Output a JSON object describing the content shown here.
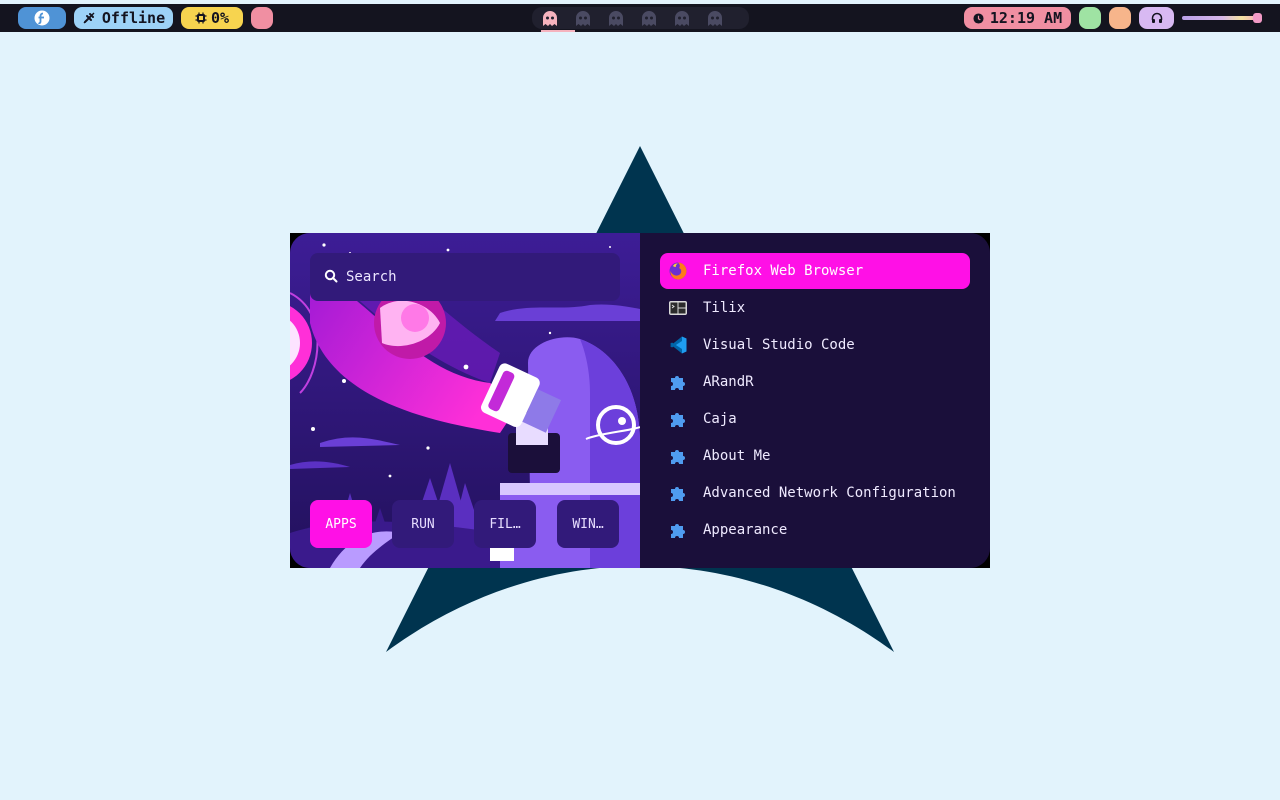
{
  "topbar": {
    "network_status": "Offline",
    "cpu_usage": "0%",
    "clock": "12:19 AM",
    "workspaces": [
      {
        "id": 1,
        "active": true
      },
      {
        "id": 2,
        "active": false
      },
      {
        "id": 3,
        "active": false
      },
      {
        "id": 4,
        "active": false
      },
      {
        "id": 5,
        "active": false
      },
      {
        "id": 6,
        "active": false
      }
    ],
    "volume_level": 0.95,
    "icons": {
      "os": "fedora-logo-icon",
      "network": "no-network-icon",
      "cpu": "cpu-chip-icon",
      "clock": "clock-icon",
      "audio": "headphones-icon"
    },
    "colors": {
      "os": "#4f93d6",
      "network": "#9dd2f7",
      "cpu": "#f7d44f",
      "pink": "#f08fa2",
      "green": "#9fe3a3",
      "peach": "#f7b58b",
      "audio": "#d8b9f2"
    }
  },
  "launcher": {
    "search_placeholder": "Search",
    "modes": [
      {
        "label": "APPS",
        "active": true
      },
      {
        "label": "RUN",
        "active": false
      },
      {
        "label": "FIL…",
        "active": false
      },
      {
        "label": "WIN…",
        "active": false
      }
    ],
    "apps": [
      {
        "label": "Firefox Web Browser",
        "icon": "firefox-icon",
        "selected": true
      },
      {
        "label": "Tilix",
        "icon": "terminal-icon",
        "selected": false
      },
      {
        "label": "Visual Studio Code",
        "icon": "vscode-icon",
        "selected": false
      },
      {
        "label": "ARandR",
        "icon": "puzzle-icon",
        "selected": false
      },
      {
        "label": "Caja",
        "icon": "puzzle-icon",
        "selected": false
      },
      {
        "label": "About Me",
        "icon": "puzzle-icon",
        "selected": false
      },
      {
        "label": "Advanced Network Configuration",
        "icon": "puzzle-icon",
        "selected": false
      },
      {
        "label": "Appearance",
        "icon": "puzzle-icon",
        "selected": false
      }
    ],
    "accent_color": "#ff10e6"
  },
  "wallpaper": {
    "background_color": "#e2f3fc",
    "logo_color": "#00344f"
  }
}
